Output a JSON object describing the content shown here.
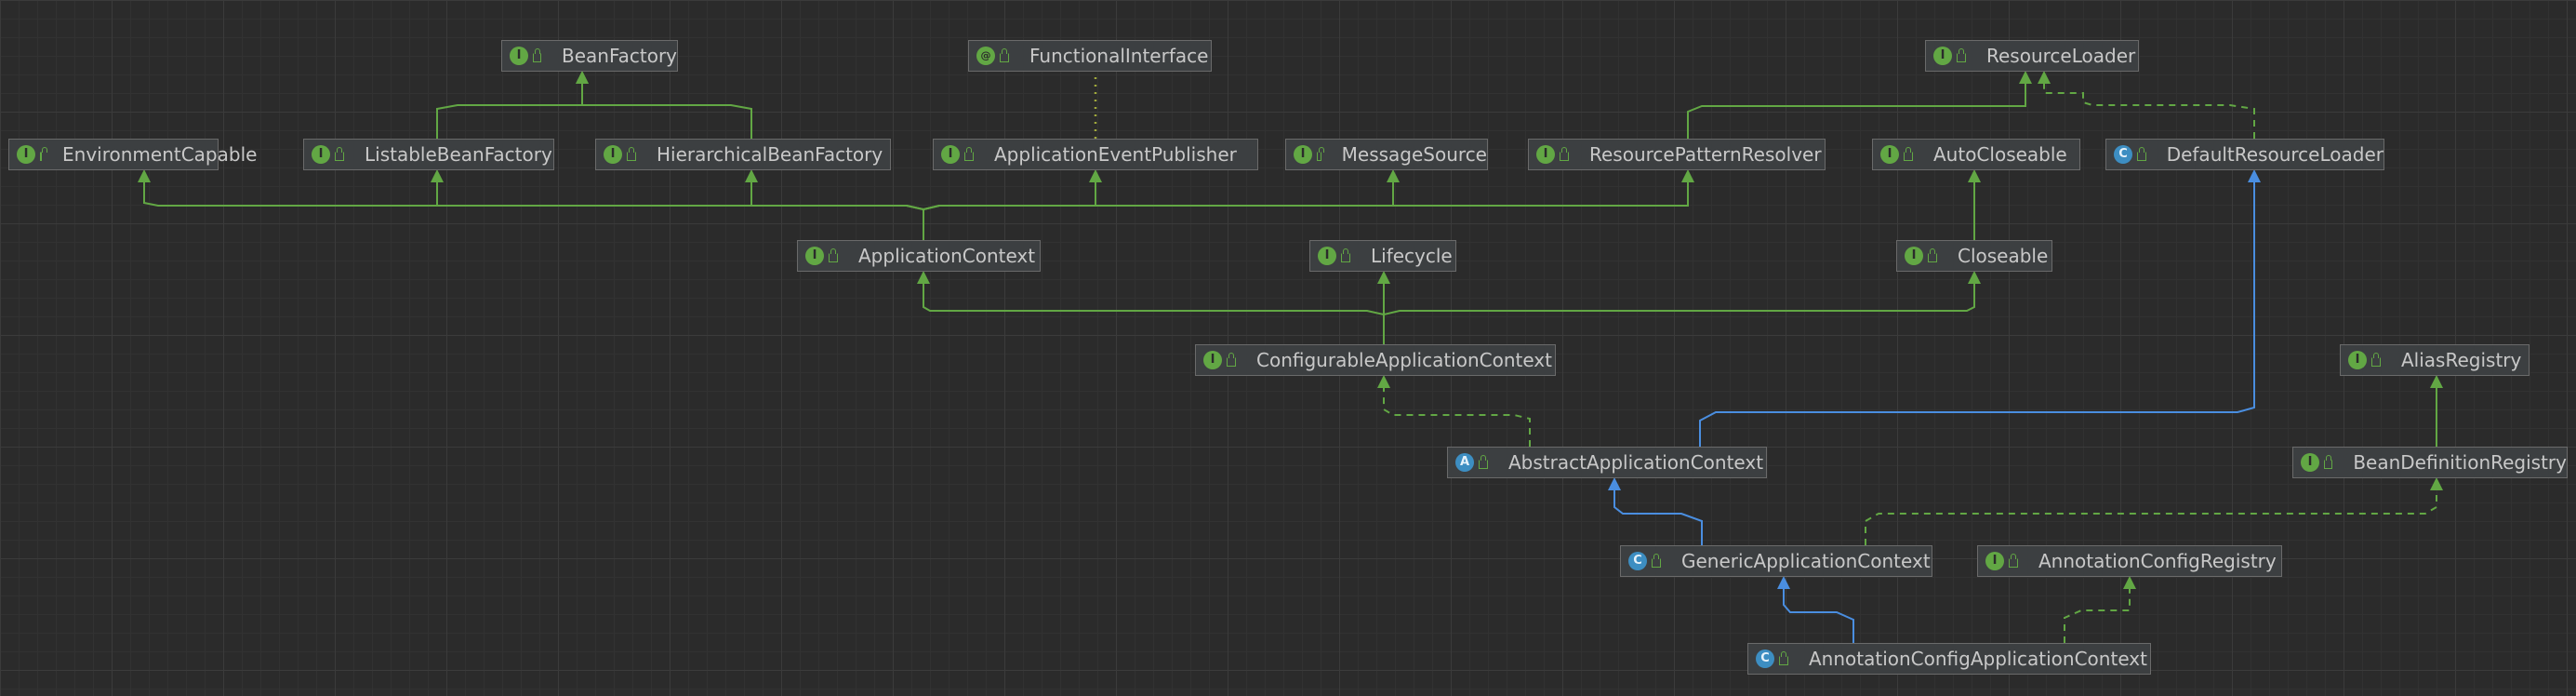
{
  "diagram": {
    "nodes": [
      {
        "id": "BeanFactory",
        "label": "BeanFactory",
        "kind": "interface"
      },
      {
        "id": "FunctionalInterface",
        "label": "FunctionalInterface",
        "kind": "annotation"
      },
      {
        "id": "ResourceLoader",
        "label": "ResourceLoader",
        "kind": "interface"
      },
      {
        "id": "EnvironmentCapable",
        "label": "EnvironmentCapable",
        "kind": "interface"
      },
      {
        "id": "ListableBeanFactory",
        "label": "ListableBeanFactory",
        "kind": "interface"
      },
      {
        "id": "HierarchicalBeanFactory",
        "label": "HierarchicalBeanFactory",
        "kind": "interface"
      },
      {
        "id": "ApplicationEventPublisher",
        "label": "ApplicationEventPublisher",
        "kind": "interface"
      },
      {
        "id": "MessageSource",
        "label": "MessageSource",
        "kind": "interface"
      },
      {
        "id": "ResourcePatternResolver",
        "label": "ResourcePatternResolver",
        "kind": "interface"
      },
      {
        "id": "AutoCloseable",
        "label": "AutoCloseable",
        "kind": "interface"
      },
      {
        "id": "DefaultResourceLoader",
        "label": "DefaultResourceLoader",
        "kind": "class"
      },
      {
        "id": "ApplicationContext",
        "label": "ApplicationContext",
        "kind": "interface"
      },
      {
        "id": "Lifecycle",
        "label": "Lifecycle",
        "kind": "interface"
      },
      {
        "id": "Closeable",
        "label": "Closeable",
        "kind": "interface"
      },
      {
        "id": "ConfigurableApplicationContext",
        "label": "ConfigurableApplicationContext",
        "kind": "interface"
      },
      {
        "id": "AliasRegistry",
        "label": "AliasRegistry",
        "kind": "interface"
      },
      {
        "id": "AbstractApplicationContext",
        "label": "AbstractApplicationContext",
        "kind": "abstract"
      },
      {
        "id": "BeanDefinitionRegistry",
        "label": "BeanDefinitionRegistry",
        "kind": "interface"
      },
      {
        "id": "GenericApplicationContext",
        "label": "GenericApplicationContext",
        "kind": "class"
      },
      {
        "id": "AnnotationConfigRegistry",
        "label": "AnnotationConfigRegistry",
        "kind": "interface"
      },
      {
        "id": "AnnotationConfigApplicationContext",
        "label": "AnnotationConfigApplicationContext",
        "kind": "class"
      }
    ],
    "edges": [
      {
        "from": "ListableBeanFactory",
        "to": "BeanFactory",
        "type": "extends"
      },
      {
        "from": "HierarchicalBeanFactory",
        "to": "BeanFactory",
        "type": "extends"
      },
      {
        "from": "ApplicationEventPublisher",
        "to": "FunctionalInterface",
        "type": "annotated"
      },
      {
        "from": "ResourcePatternResolver",
        "to": "ResourceLoader",
        "type": "extends"
      },
      {
        "from": "DefaultResourceLoader",
        "to": "ResourceLoader",
        "type": "implements"
      },
      {
        "from": "ApplicationContext",
        "to": "EnvironmentCapable",
        "type": "extends"
      },
      {
        "from": "ApplicationContext",
        "to": "ListableBeanFactory",
        "type": "extends"
      },
      {
        "from": "ApplicationContext",
        "to": "HierarchicalBeanFactory",
        "type": "extends"
      },
      {
        "from": "ApplicationContext",
        "to": "ApplicationEventPublisher",
        "type": "extends"
      },
      {
        "from": "ApplicationContext",
        "to": "MessageSource",
        "type": "extends"
      },
      {
        "from": "ApplicationContext",
        "to": "ResourcePatternResolver",
        "type": "extends"
      },
      {
        "from": "Closeable",
        "to": "AutoCloseable",
        "type": "extends"
      },
      {
        "from": "ConfigurableApplicationContext",
        "to": "ApplicationContext",
        "type": "extends"
      },
      {
        "from": "ConfigurableApplicationContext",
        "to": "Lifecycle",
        "type": "extends"
      },
      {
        "from": "ConfigurableApplicationContext",
        "to": "Closeable",
        "type": "extends"
      },
      {
        "from": "AbstractApplicationContext",
        "to": "ConfigurableApplicationContext",
        "type": "implements"
      },
      {
        "from": "AbstractApplicationContext",
        "to": "DefaultResourceLoader",
        "type": "class-extends"
      },
      {
        "from": "BeanDefinitionRegistry",
        "to": "AliasRegistry",
        "type": "extends"
      },
      {
        "from": "GenericApplicationContext",
        "to": "AbstractApplicationContext",
        "type": "class-extends"
      },
      {
        "from": "GenericApplicationContext",
        "to": "BeanDefinitionRegistry",
        "type": "implements"
      },
      {
        "from": "AnnotationConfigApplicationContext",
        "to": "GenericApplicationContext",
        "type": "class-extends"
      },
      {
        "from": "AnnotationConfigApplicationContext",
        "to": "AnnotationConfigRegistry",
        "type": "implements"
      }
    ]
  },
  "colors": {
    "background": "#2b2b2b",
    "interface_edge": "#62a744",
    "class_edge": "#4a8ee0",
    "annotation_edge": "#a0a83c",
    "node_bg": "#3c3f41",
    "node_border": "#6a6a6a",
    "node_text": "#c8c8c8"
  },
  "icons": {
    "interface": "I",
    "class": "C",
    "abstract": "A",
    "annotation": "@"
  }
}
